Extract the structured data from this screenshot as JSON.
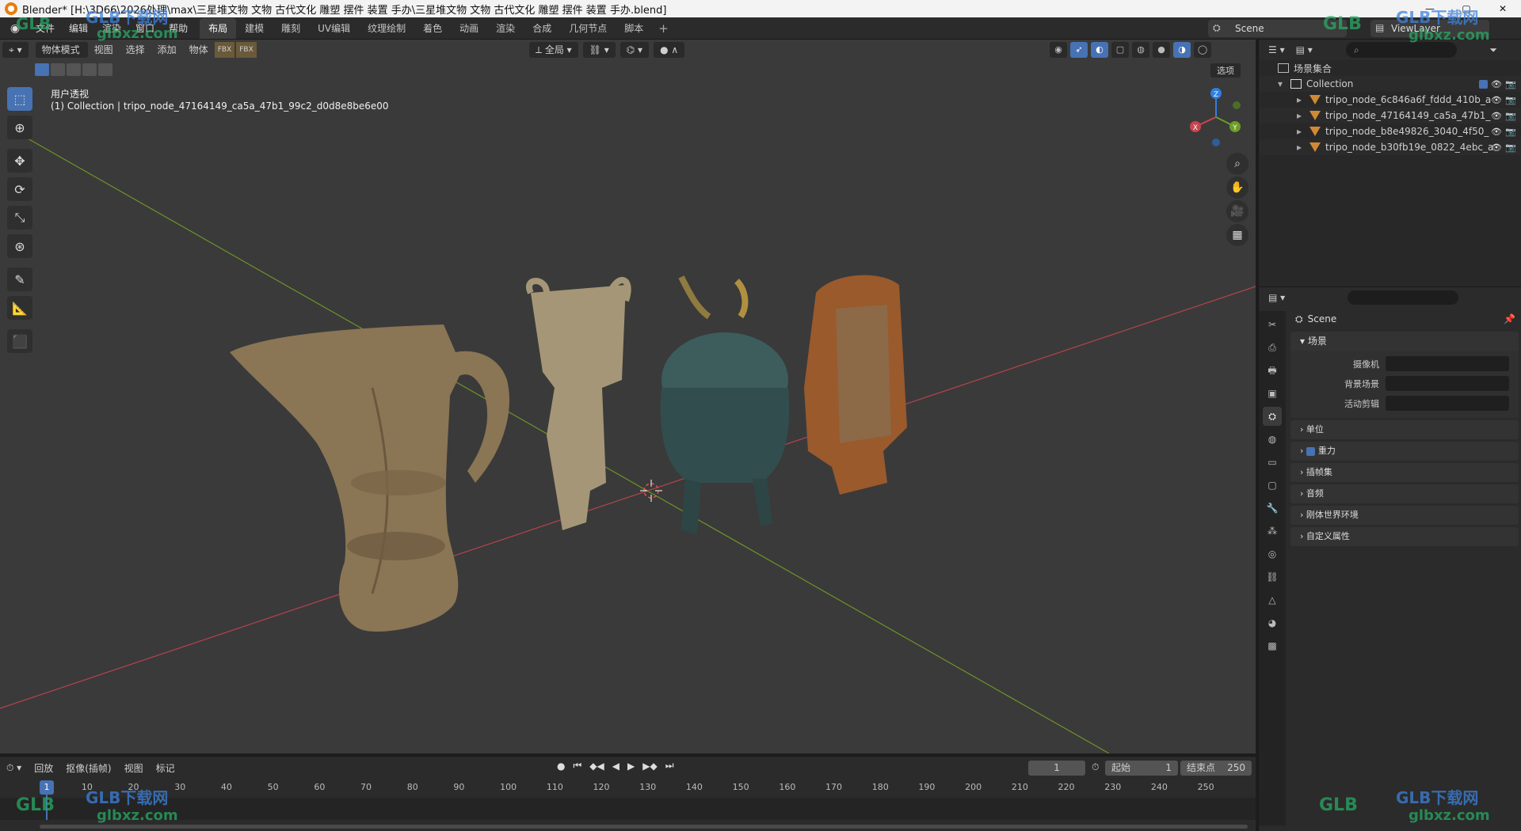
{
  "titlebar": {
    "title": "Blender* [H:\\3D66\\2026处理\\max\\三星堆文物 文物 古代文化     雕塑 摆件 装置 手办\\三星堆文物 文物 古代文化     雕塑 摆件 装置 手办.blend]",
    "minimize": "—",
    "maximize": "▢",
    "close": "✕"
  },
  "topbar": {
    "menu": [
      "文件",
      "编辑",
      "渲染",
      "窗口",
      "帮助"
    ],
    "workspaces": [
      "布局",
      "建模",
      "雕刻",
      "UV编辑",
      "纹理绘制",
      "着色",
      "动画",
      "渲染",
      "合成",
      "几何节点",
      "脚本"
    ],
    "active_workspace": "布局",
    "add_workspace": "+",
    "scene_name": "Scene",
    "view_layer": "ViewLayer"
  },
  "viewport": {
    "mode": "物体模式",
    "menus": [
      "视图",
      "选择",
      "添加",
      "物体"
    ],
    "transform_orientation": "全局",
    "options": "选项",
    "view_name": "用户透视",
    "active_info": "(1) Collection | tripo_node_47164149_ca5a_47b1_99c2_d0d8e8be6e00",
    "tools": [
      "select-box",
      "cursor",
      "move",
      "rotate",
      "scale",
      "transform",
      "annotate",
      "measure",
      "add-cube"
    ],
    "gizmo_axes": [
      "Z",
      "Y",
      "X"
    ],
    "colors": {
      "x_axis": "#c9454f",
      "y_axis": "#6d9d26",
      "z_axis": "#2f7fe0",
      "bg": "#3a3a3a"
    }
  },
  "timeline": {
    "menus": [
      "回放",
      "抠像(插帧)",
      "视图",
      "标记"
    ],
    "current_frame": "1",
    "start_label": "起始",
    "start_value": "1",
    "end_label": "结束点",
    "end_value": "250",
    "ticks": [
      "10",
      "20",
      "30",
      "40",
      "50",
      "60",
      "70",
      "80",
      "90",
      "100",
      "110",
      "120",
      "130",
      "140",
      "150",
      "160",
      "170",
      "180",
      "190",
      "200",
      "210",
      "220",
      "230",
      "240",
      "250"
    ],
    "playhead": "1"
  },
  "outliner": {
    "root": "场景集合",
    "collection": "Collection",
    "objects": [
      "tripo_node_6c846a6f_fddd_410b_a",
      "tripo_node_47164149_ca5a_47b1_",
      "tripo_node_b8e49826_3040_4f50_",
      "tripo_node_b30fb19e_0822_4ebc_a"
    ]
  },
  "properties": {
    "breadcrumb": "Scene",
    "panel_scene": "场景",
    "fields": [
      {
        "label": "摄像机"
      },
      {
        "label": "背景场景"
      },
      {
        "label": "活动剪辑"
      }
    ],
    "subpanels": [
      "单位",
      "重力",
      "插帧集",
      "音频",
      "刚体世界环境",
      "自定义属性"
    ]
  },
  "watermarks": {
    "brand": "GLB下载网",
    "url": "glbxz.com",
    "logo": "GLB"
  }
}
